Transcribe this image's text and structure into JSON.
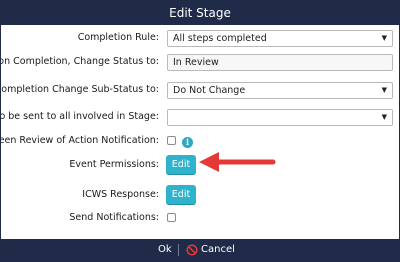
{
  "dialog": {
    "title": "Edit Stage"
  },
  "fields": {
    "completion_rule": {
      "label": "Completion Rule:",
      "value": "All steps completed"
    },
    "change_status": {
      "label": "Upon Completion, Change Status to:",
      "value": "In Review"
    },
    "change_sub_status": {
      "label": "Upon Completion Change Sub-Status to:",
      "value": "Do Not Change"
    },
    "report_all": {
      "label": "Report to be sent to all involved in Stage:",
      "value": ""
    },
    "on_screen_review": {
      "label": "On Screen Review of Action Notification:",
      "checked": false,
      "info_icon": "info-icon"
    },
    "event_permissions": {
      "label": "Event Permissions:",
      "button": "Edit"
    },
    "icws_response": {
      "label": "ICWS Response:",
      "button": "Edit"
    },
    "send_notifications": {
      "label": "Send Notifications:",
      "checked": false
    }
  },
  "annotation": {
    "arrow_color": "#e53935",
    "icon": "red-arrow-icon"
  },
  "footer": {
    "ok_label": "Ok",
    "cancel_label": "Cancel",
    "cancel_icon": "no-entry-icon"
  },
  "colors": {
    "titlebar": "#1f2b48",
    "edit_button": "#2fb3cc",
    "info_icon": "#2fa7bf"
  }
}
